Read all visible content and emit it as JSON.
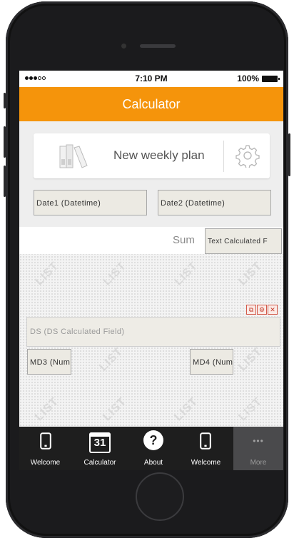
{
  "status_bar": {
    "time": "7:10 PM",
    "battery": "100%"
  },
  "nav": {
    "title": "Calculator"
  },
  "plan_card": {
    "label": "New weekly plan",
    "icons": [
      "books-icon",
      "gear-icon"
    ]
  },
  "fields": {
    "date1": "Date1 (Datetime)",
    "date2": "Date2 (Datetime)",
    "sum_label": "Sum",
    "sum_value": "Text Calculated F",
    "ds": "DS (DS Calculated Field)",
    "md3": "MD3 (Num",
    "md4": "MD4 (Num"
  },
  "watermark": "LIST",
  "tabs": [
    {
      "label": "Welcome",
      "icon": "phone-icon"
    },
    {
      "label": "Calculator",
      "icon": "calendar-icon",
      "calendar_day": "31"
    },
    {
      "label": "About",
      "icon": "help-icon",
      "glyph": "?"
    },
    {
      "label": "Welcome",
      "icon": "phone-icon"
    },
    {
      "label": "More",
      "icon": "more-icon",
      "glyph": "•••"
    }
  ],
  "colors": {
    "accent": "#f5940b",
    "tabbar": "#1e1e1e",
    "more_tab": "#4a4a4c"
  }
}
